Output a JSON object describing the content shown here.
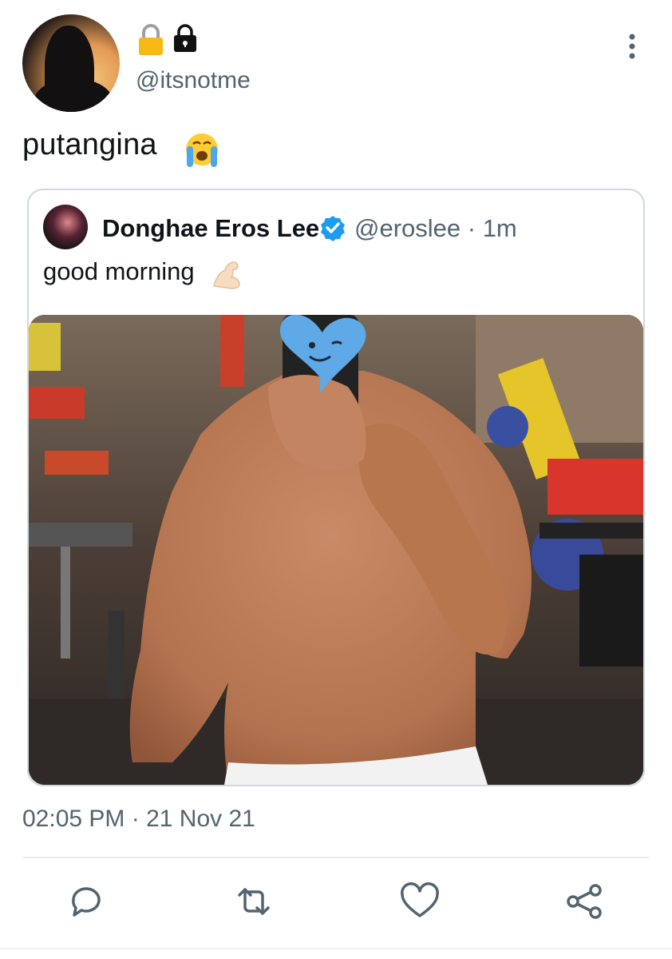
{
  "tweet": {
    "avatar_icon": "profile-avatar",
    "name_icons": [
      "lock-yellow-icon",
      "lock-black-icon"
    ],
    "handle": "@itsnotme",
    "text": "putangina",
    "text_emoji": "loudly-crying-face-icon",
    "menu_icon": "more-vertical-icon",
    "timestamp": "02:05 PM · 21 Nov 21"
  },
  "quoted": {
    "name": "Donghae Eros Lee",
    "verified": true,
    "handle_time": "@eroslee · 1m",
    "text": "good morning",
    "text_emoji": "flexed-biceps-icon",
    "media": "gym-mirror-selfie-photo"
  },
  "actions": [
    {
      "icon": "reply-icon"
    },
    {
      "icon": "retweet-icon"
    },
    {
      "icon": "like-heart-icon"
    },
    {
      "icon": "share-icon"
    }
  ],
  "colors": {
    "secondary_text": "#536471",
    "verified_blue": "#1d9bf0",
    "border": "#cfd9de",
    "action_icon": "#536471"
  }
}
